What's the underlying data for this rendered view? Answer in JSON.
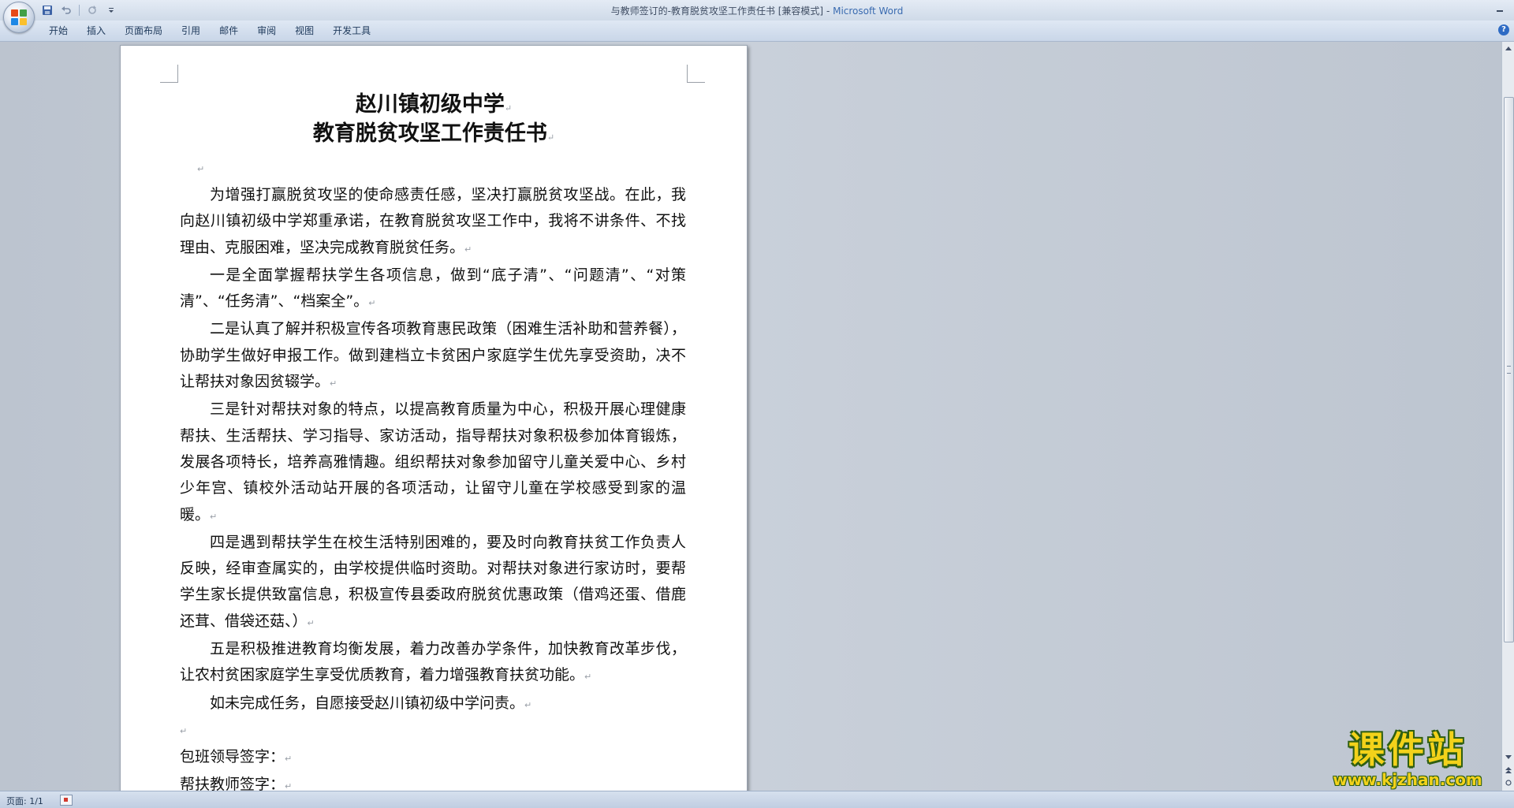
{
  "window": {
    "title": "与教师签订的-教育脱贫攻坚工作责任书 [兼容模式]",
    "title_sep": " - ",
    "app_name": "Microsoft Word"
  },
  "ribbon": {
    "tabs": [
      {
        "label": "开始"
      },
      {
        "label": "插入"
      },
      {
        "label": "页面布局"
      },
      {
        "label": "引用"
      },
      {
        "label": "邮件"
      },
      {
        "label": "审阅"
      },
      {
        "label": "视图"
      },
      {
        "label": "开发工具"
      }
    ]
  },
  "document": {
    "title_line1": "赵川镇初级中学",
    "title_line2": "教育脱贫攻坚工作责任书",
    "paragraphs": [
      "为增强打赢脱贫攻坚的使命感责任感，坚决打赢脱贫攻坚战。在此，我向赵川镇初级中学郑重承诺，在教育脱贫攻坚工作中，我将不讲条件、不找理由、克服困难，坚决完成教育脱贫任务。",
      "一是全面掌握帮扶学生各项信息，做到“底子清”、“问题清”、“对策清”、“任务清”、“档案全”。",
      "二是认真了解并积极宣传各项教育惠民政策（困难生活补助和营养餐），协助学生做好申报工作。做到建档立卡贫困户家庭学生优先享受资助，决不让帮扶对象因贫辍学。",
      "三是针对帮扶对象的特点，以提高教育质量为中心，积极开展心理健康帮扶、生活帮扶、学习指导、家访活动，指导帮扶对象积极参加体育锻炼，发展各项特长，培养高雅情趣。组织帮扶对象参加留守儿童关爱中心、乡村少年宫、镇校外活动站开展的各项活动，让留守儿童在学校感受到家的温暖。",
      "四是遇到帮扶学生在校生活特别困难的，要及时向教育扶贫工作负责人反映，经审查属实的，由学校提供临时资助。对帮扶对象进行家访时，要帮学生家长提供致富信息，积极宣传县委政府脱贫优惠政策（借鸡还蛋、借鹿还茸、借袋还菇、）",
      "五是积极推进教育均衡发展，着力改善办学条件，加快教育改革步伐，让农村贫困家庭学生享受优质教育，着力增强教育扶贫功能。",
      "如未完成任务，自愿接受赵川镇初级中学问责。"
    ],
    "signature_leader": "包班领导签字：",
    "signature_teacher": "帮扶教师签字："
  },
  "statusbar": {
    "page_info": "页面: 1/1"
  },
  "watermark": {
    "text_cn": "课件站",
    "url": "www.kjzhan.com"
  },
  "icons": {
    "office_button": "office-logo-icon",
    "save": "save-icon",
    "undo": "undo-icon",
    "redo": "redo-icon",
    "qat_menu": "dropdown-icon",
    "minimize": "minimize-icon",
    "help": "help-icon",
    "scroll_up": "arrow-up-icon",
    "scroll_down": "arrow-down-icon"
  },
  "colors": {
    "app_name": "#3a6bb0",
    "watermark_fill": "#f3d21a",
    "watermark_outline": "#2f5f12"
  }
}
